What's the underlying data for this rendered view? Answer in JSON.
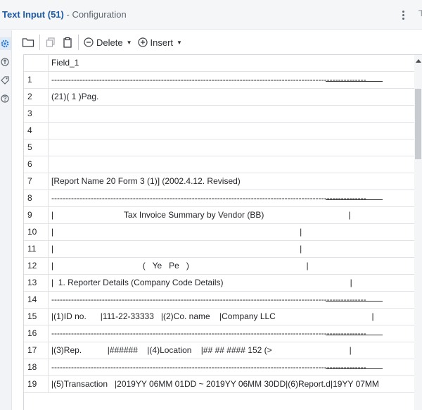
{
  "window": {
    "title": "Text Input (51)",
    "subtitle": "- Configuration"
  },
  "rail": {
    "items": [
      "gear-icon",
      "workflow-icon",
      "tag-icon",
      "help-icon"
    ]
  },
  "toolbar": {
    "delete_label": "Delete",
    "insert_label": "Insert"
  },
  "table": {
    "column_header": "Field_1",
    "rows": [
      {
        "num": "1",
        "text": "----------------------------------------------------------------------------------------------------------------"
      },
      {
        "num": "2",
        "text": "(21)( 1 )Pag."
      },
      {
        "num": "3",
        "text": ""
      },
      {
        "num": "4",
        "text": ""
      },
      {
        "num": "5",
        "text": ""
      },
      {
        "num": "6",
        "text": ""
      },
      {
        "num": "7",
        "text": "[Report Name 20 Form 3 (1)] (2002.4.12. Revised)"
      },
      {
        "num": "8",
        "text": "----------------------------------------------------------------------------------------------------------------"
      },
      {
        "num": "9",
        "text": "|                              Tax Invoice Summary by Vendor (BB)                                    |"
      },
      {
        "num": "10",
        "text": "|                                                                                                         |"
      },
      {
        "num": "11",
        "text": "|                                                                                                         |"
      },
      {
        "num": "12",
        "text": "|                                      (   Ye   Pe   )                                                  |"
      },
      {
        "num": "13",
        "text": "|  1. Reporter Details (Company Code Details)                                                      |"
      },
      {
        "num": "14",
        "text": "----------------------------------------------------------------------------------------------------------------"
      },
      {
        "num": "15",
        "text": "|(1)ID no.      |111-22-33333   |(2)Co. name    |Company LLC                                         |"
      },
      {
        "num": "16",
        "text": "----------------------------------------------------------------------------------------------------------------"
      },
      {
        "num": "17",
        "text": "|(3)Rep.           |######    |(4)Location    |## ## #### 152 (>                                 |"
      },
      {
        "num": "18",
        "text": "----------------------------------------------------------------------------------------------------------------"
      },
      {
        "num": "19",
        "text": "|(5)Transaction   |2019YY 06MM 01DD ~ 2019YY 06MM 30DD|(6)Report.d|19YY 07MM"
      }
    ]
  },
  "colors": {
    "title": "#1d5aa6",
    "accent": "#2d7dd2"
  }
}
